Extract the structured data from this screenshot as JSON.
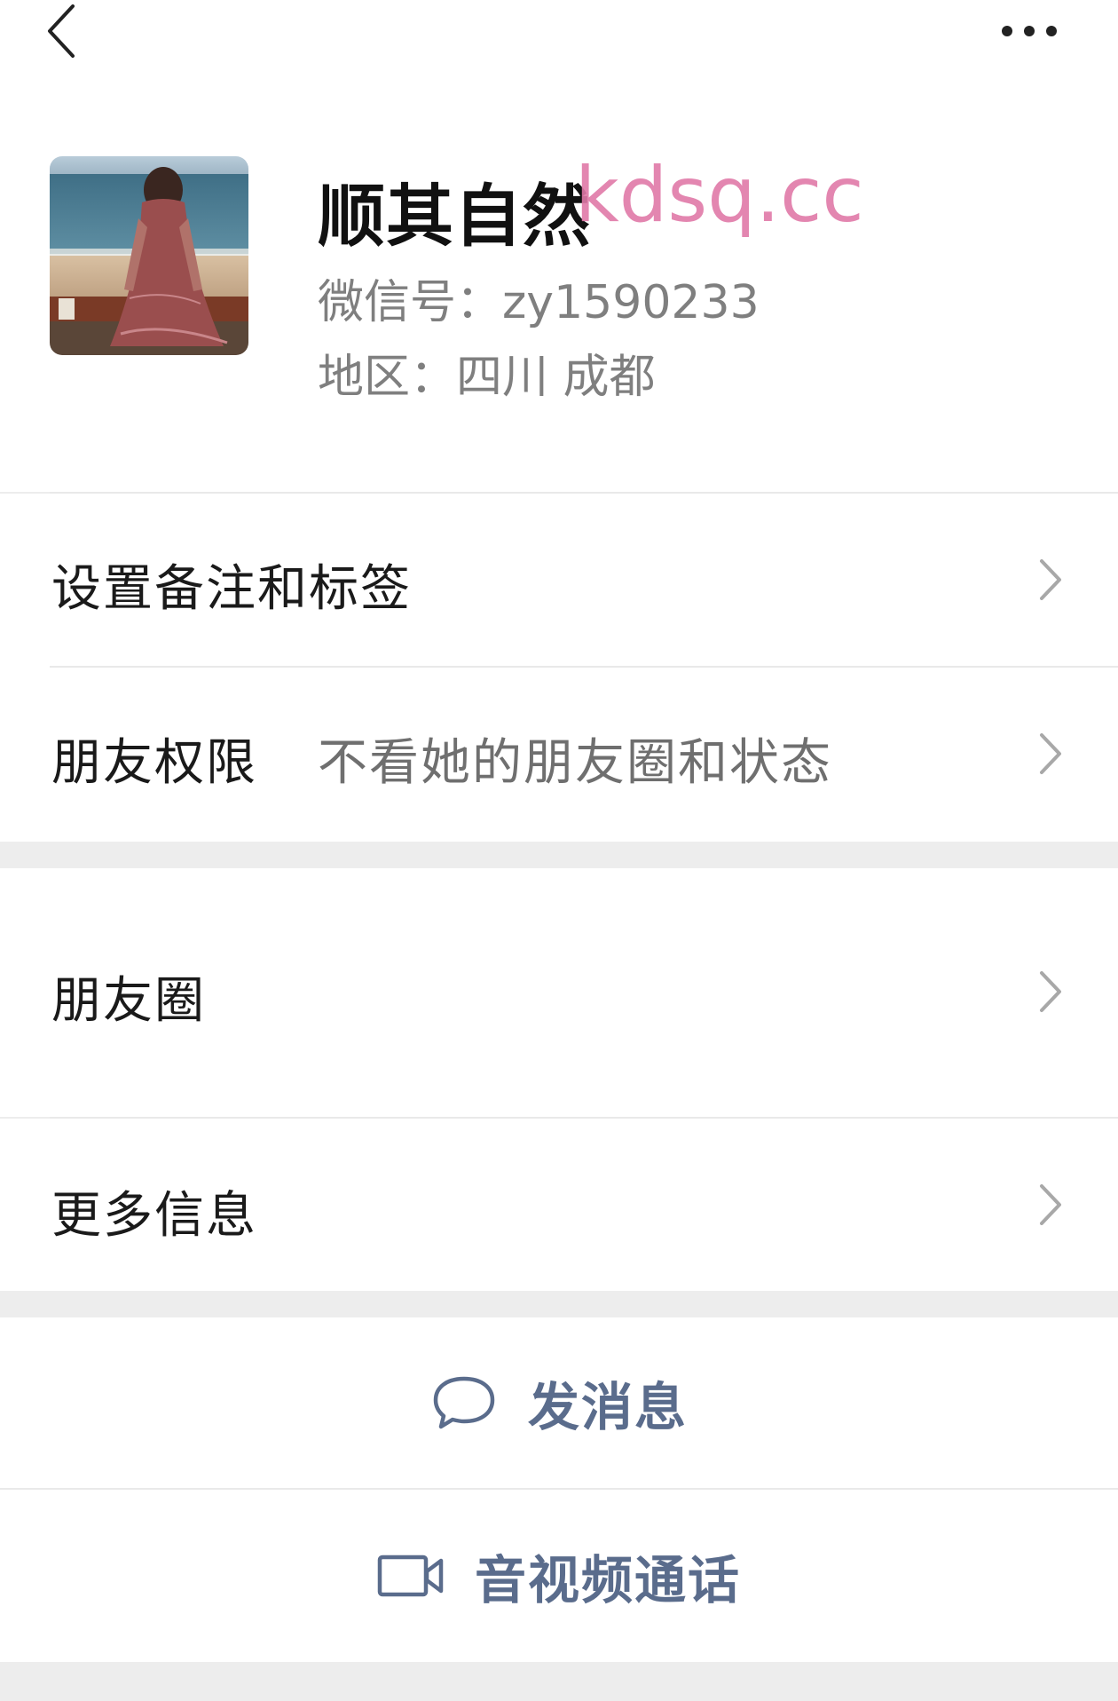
{
  "header": {
    "back_icon": "chevron-left-icon",
    "more_icon": "more-horizontal-icon"
  },
  "profile": {
    "name": "顺其自然",
    "watermark": "kdsq.cc",
    "wechat_id": "微信号：zy1590233",
    "region": "地区：四川  成都"
  },
  "rows": {
    "remark": {
      "label": "设置备注和标签"
    },
    "permission": {
      "label": "朋友权限",
      "value": "不看她的朋友圈和状态"
    },
    "moments": {
      "label": "朋友圈"
    },
    "more_info": {
      "label": "更多信息"
    }
  },
  "actions": {
    "message": {
      "label": "发消息",
      "icon": "chat-bubble-icon"
    },
    "call": {
      "label": "音视频通话",
      "icon": "video-camera-icon"
    }
  },
  "colors": {
    "background": "#ededed",
    "card": "#ffffff",
    "action_text": "#5a6c8c",
    "secondary_text": "#7f7f7f",
    "watermark": "#e07aa8"
  }
}
